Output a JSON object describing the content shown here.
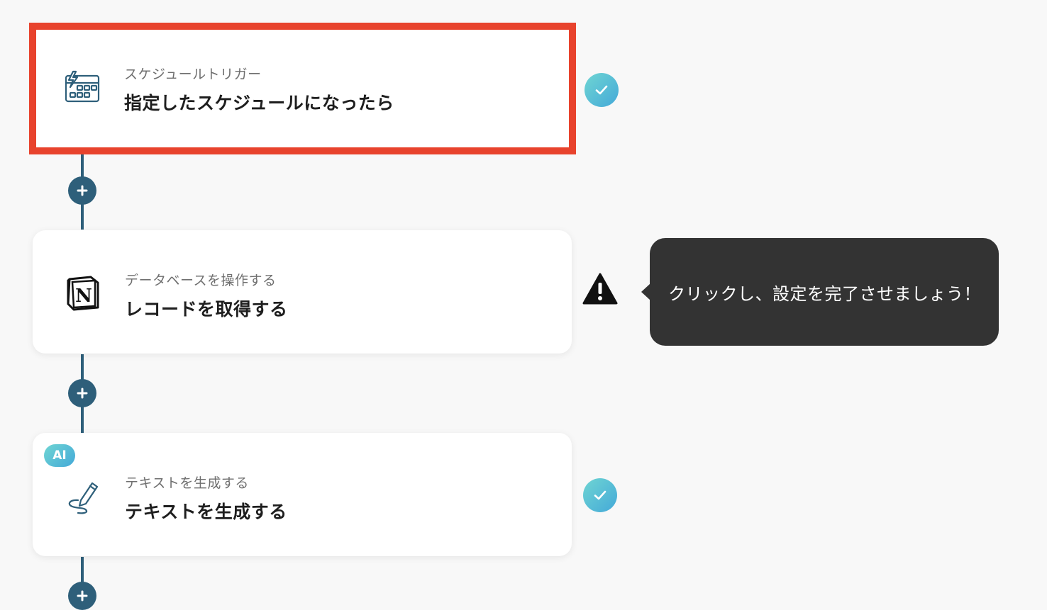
{
  "steps": [
    {
      "subtitle": "スケジュールトリガー",
      "title": "指定したスケジュールになったら",
      "icon": "calendar-lightning-icon",
      "status": "complete"
    },
    {
      "subtitle": "データベースを操作する",
      "title": "レコードを取得する",
      "icon": "notion-icon",
      "icon_text": "N",
      "status": "warning"
    },
    {
      "subtitle": "テキストを生成する",
      "title": "テキストを生成する",
      "icon": "pen-icon",
      "badge": "AI",
      "status": "complete"
    }
  ],
  "tooltip": {
    "text": "クリックし、設定を完了させましょう！"
  },
  "colors": {
    "connector": "#2e5f7a",
    "highlight_border": "#e8432d",
    "check_gradient_start": "#6fd5d3",
    "check_gradient_end": "#44a9d8",
    "tooltip_bg": "#333333"
  }
}
